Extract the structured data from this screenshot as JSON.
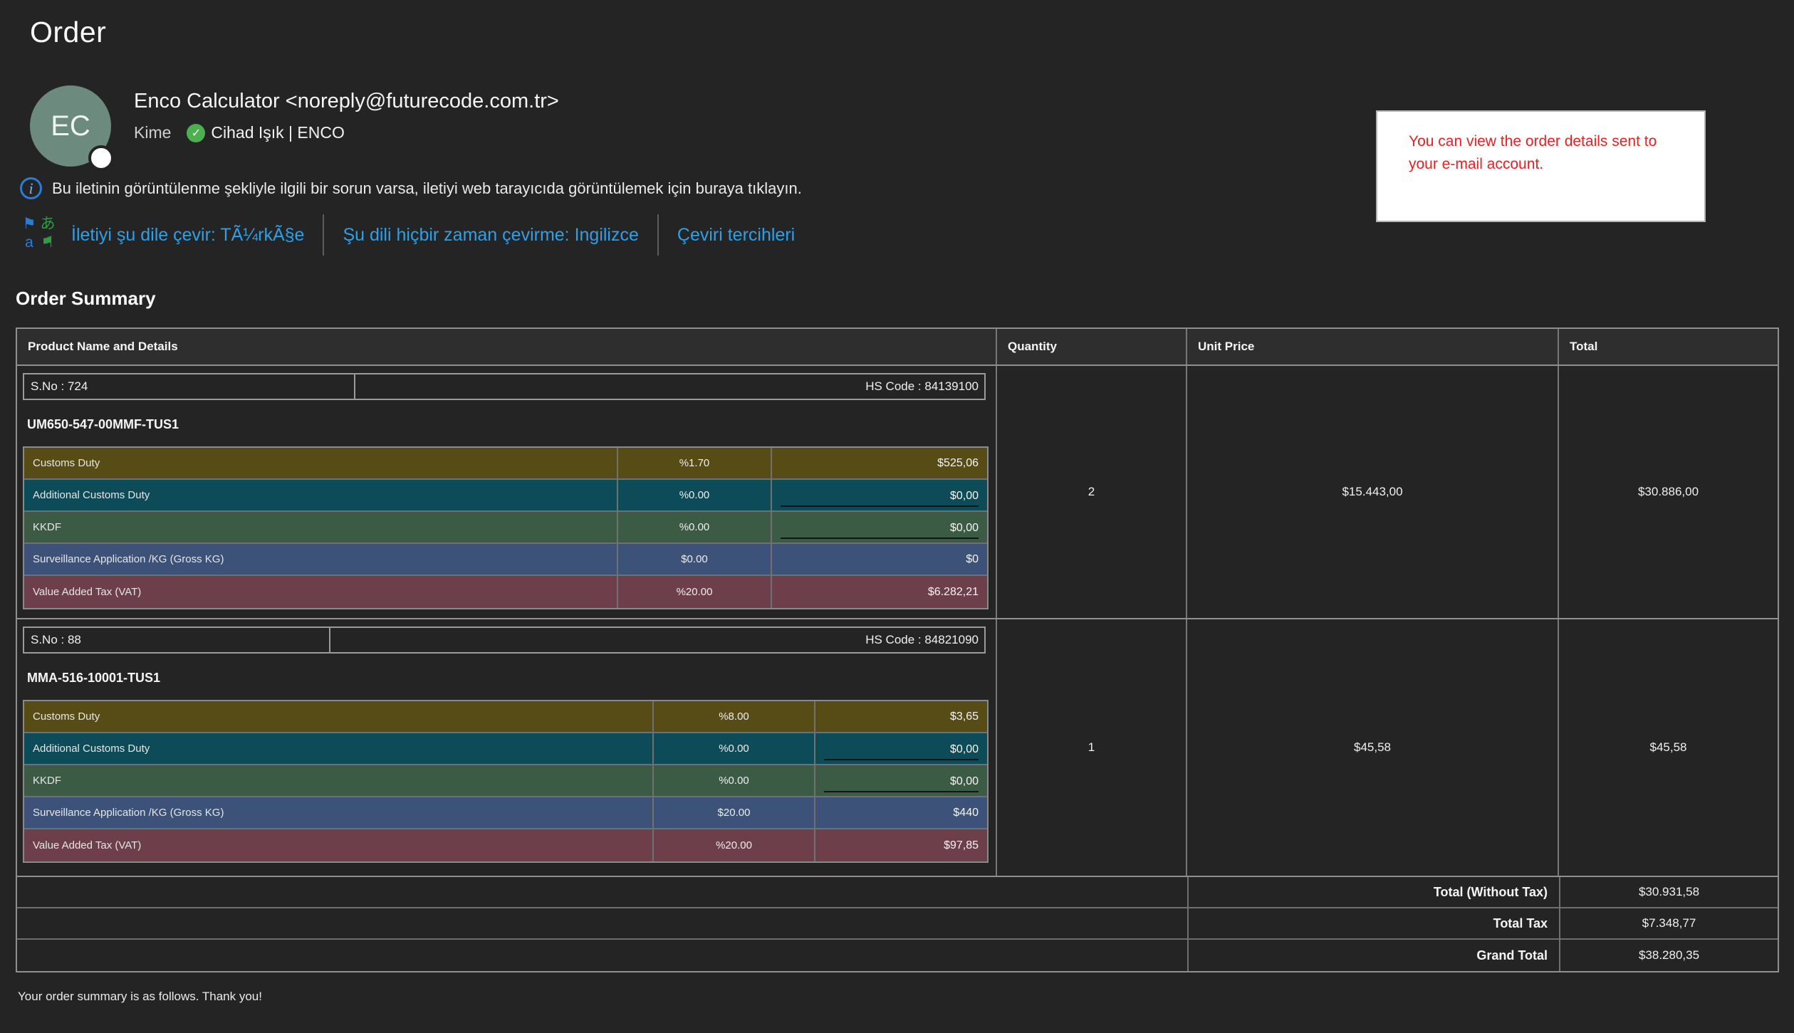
{
  "page": {
    "title": "Order",
    "footer": "Your order summary is as follows. Thank you!"
  },
  "sender": {
    "avatar_initials": "EC",
    "name_line": "Enco Calculator <noreply@futurecode.com.tr>",
    "to_label": "Kime",
    "recipient": "Cihad Işık | ENCO"
  },
  "notice": {
    "text": "Bu iletinin görüntülenme şekliyle ilgili bir sorun varsa, iletiyi web tarayıcıda görüntülemek için buraya tıklayın."
  },
  "translate": {
    "icon_glyphs": {
      "flag": "⚑",
      "latin": "a",
      "kana": "あ"
    },
    "translate_link": "İletiyi şu dile çevir: TÃ¼rkÃ§e",
    "never_translate_link": "Şu dili hiçbir zaman çevirme: Ingilizce",
    "preferences_link": "Çeviri tercihleri"
  },
  "annotation": {
    "text": "You can view the order details sent to your e-mail account."
  },
  "summary": {
    "heading": "Order Summary",
    "columns": {
      "product": "Product Name and Details",
      "quantity": "Quantity",
      "unit_price": "Unit Price",
      "total": "Total"
    },
    "products": [
      {
        "sno": "S.No : 724",
        "hs_code": "HS Code : 84139100",
        "name": "UM650-547-00MMF-TUS1",
        "quantity": "2",
        "unit_price": "$15.443,00",
        "total": "$30.886,00",
        "taxes": [
          {
            "label": "Customs Duty",
            "rate": "%1.70",
            "amount": "$525,06"
          },
          {
            "label": "Additional Customs Duty",
            "rate": "%0.00",
            "amount": "$0,00"
          },
          {
            "label": "KKDF",
            "rate": "%0.00",
            "amount": "$0,00"
          },
          {
            "label": "Surveillance Application /KG (Gross KG)",
            "rate": "$0.00",
            "amount": "$0"
          },
          {
            "label": "Value Added Tax (VAT)",
            "rate": "%20.00",
            "amount": "$6.282,21"
          }
        ]
      },
      {
        "sno": "S.No : 88",
        "hs_code": "HS Code : 84821090",
        "name": "MMA-516-10001-TUS1",
        "quantity": "1",
        "unit_price": "$45,58",
        "total": "$45,58",
        "taxes": [
          {
            "label": "Customs Duty",
            "rate": "%8.00",
            "amount": "$3,65"
          },
          {
            "label": "Additional Customs Duty",
            "rate": "%0.00",
            "amount": "$0,00"
          },
          {
            "label": "KKDF",
            "rate": "%0.00",
            "amount": "$0,00"
          },
          {
            "label": "Surveillance Application /KG (Gross KG)",
            "rate": "$20.00",
            "amount": "$440"
          },
          {
            "label": "Value Added Tax (VAT)",
            "rate": "%20.00",
            "amount": "$97,85"
          }
        ]
      }
    ],
    "totals": [
      {
        "label": "Total (Without Tax)",
        "value": "$30.931,58"
      },
      {
        "label": "Total Tax",
        "value": "$7.348,77"
      },
      {
        "label": "Grand Total",
        "value": "$38.280,35"
      }
    ]
  },
  "colors": {
    "page_bg": "#242424",
    "avatar_green": "#6c8a7e",
    "check_green": "#4caf50",
    "info_blue": "#2b7cd3",
    "link_blue": "#2ca0e8",
    "annotation_red": "#ee1f1f",
    "tax_rows": [
      "#574b16",
      "#0c4b57",
      "#3c5b44",
      "#3c5278",
      "#6d3f4a"
    ]
  }
}
